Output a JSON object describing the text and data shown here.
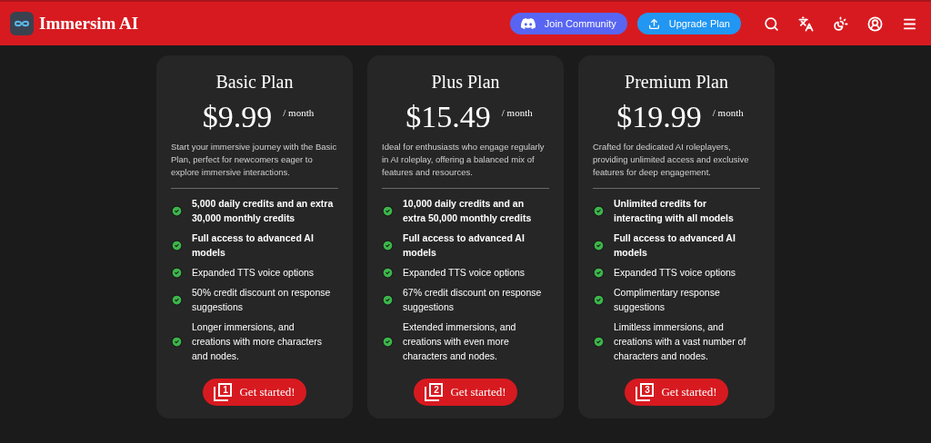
{
  "header": {
    "title": "Immersim AI",
    "buttons": [
      {
        "label": "Join Community",
        "kind": "discord"
      },
      {
        "label": "Upgrade Plan",
        "kind": "upgrade"
      }
    ]
  },
  "plans": [
    {
      "name": "Basic Plan",
      "price": "$9.99",
      "period": "/ month",
      "description": "Start your immersive journey with the Basic Plan, perfect for newcomers eager to explore immersive interactions.",
      "features": [
        {
          "text": "5,000 daily credits and an extra 30,000 monthly credits",
          "emphasized": true
        },
        {
          "text": "Full access to advanced AI models",
          "emphasized": true
        },
        {
          "text": "Expanded TTS voice options",
          "emphasized": false
        },
        {
          "text": "50% credit discount on response suggestions",
          "emphasized": false
        },
        {
          "text": "Longer immersions, and creations with more characters and nodes.",
          "emphasized": false
        }
      ],
      "button": {
        "number": "1",
        "label": "Get started!"
      }
    },
    {
      "name": "Plus Plan",
      "price": "$15.49",
      "period": "/ month",
      "description": "Ideal for enthusiasts who engage regularly in AI roleplay, offering a balanced mix of features and resources.",
      "features": [
        {
          "text": "10,000 daily credits and an extra 50,000 monthly credits",
          "emphasized": true
        },
        {
          "text": "Full access to advanced AI models",
          "emphasized": true
        },
        {
          "text": "Expanded TTS voice options",
          "emphasized": false
        },
        {
          "text": "67% credit discount on response suggestions",
          "emphasized": false
        },
        {
          "text": "Extended immersions, and creations with even more characters and nodes.",
          "emphasized": false
        }
      ],
      "button": {
        "number": "2",
        "label": "Get started!"
      }
    },
    {
      "name": "Premium Plan",
      "price": "$19.99",
      "period": "/ month",
      "description": "Crafted for dedicated AI roleplayers, providing unlimited access and exclusive features for deep engagement.",
      "features": [
        {
          "text": "Unlimited credits for interacting with all models",
          "emphasized": true
        },
        {
          "text": "Full access to advanced AI models",
          "emphasized": true
        },
        {
          "text": "Expanded TTS voice options",
          "emphasized": false
        },
        {
          "text": "Complimentary response suggestions",
          "emphasized": false
        },
        {
          "text": "Limitless immersions, and creations with a vast number of characters and nodes.",
          "emphasized": false
        }
      ],
      "button": {
        "number": "3",
        "label": "Get started!"
      }
    }
  ]
}
